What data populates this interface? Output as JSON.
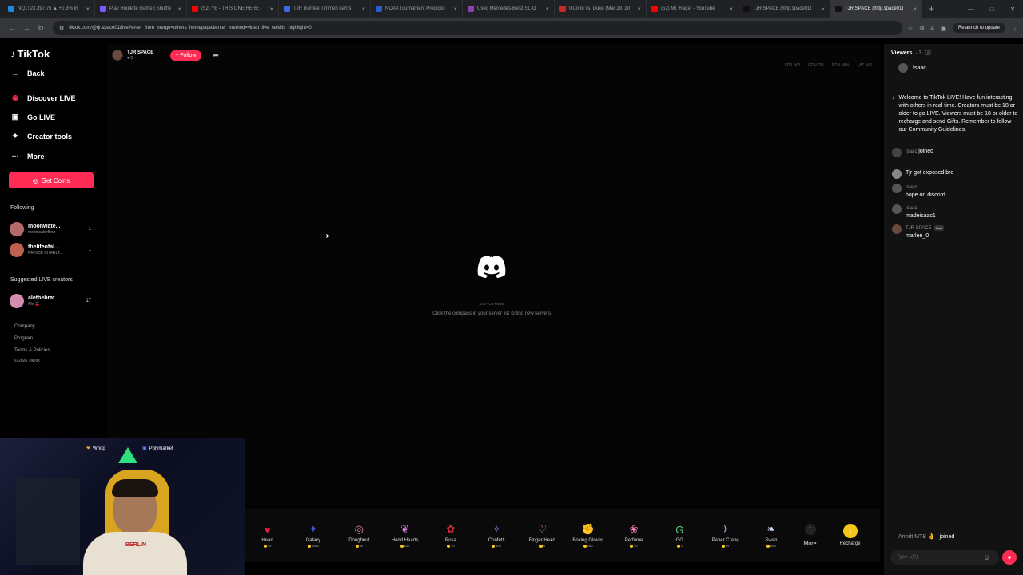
{
  "browser": {
    "tabs": [
      {
        "title": "NQ1! 23,397.75 ▲ +0.3% In",
        "color": "#1e88e5",
        "active": false
      },
      {
        "title": "Play Roulette Game | Shuffle",
        "color": "#7b5cff",
        "active": false
      },
      {
        "title": "(52) YE - THIS ONE HERE -",
        "color": "#ff0000",
        "active": false
      },
      {
        "title": "TJR mentee Timmeh earns",
        "color": "#3a6ae0",
        "active": false
      },
      {
        "title": "NCAA Tournament Predictio",
        "color": "#2a5bd7",
        "active": false
      },
      {
        "title": "Used Mercedes-Benz SL-Cl",
        "color": "#8e44ad",
        "active": false
      },
      {
        "title": "UConn vs. Duke (Mar 29, 20",
        "color": "#c62828",
        "active": false
      },
      {
        "title": "(52) Mr. Rager - YouTube",
        "color": "#ff0000",
        "active": false
      },
      {
        "title": "TJR SPACE (@tjr.space01)",
        "color": "#111111",
        "active": false
      },
      {
        "title": "TJR SPACE (@tjr.space01)",
        "color": "#111111",
        "active": true
      }
    ],
    "url": "tiktok.com/@tjr.space01/live?enter_from_merge=others_homepage&enter_method=video_live_cell&is_highlight=0",
    "relaunch": "Relaunch to update"
  },
  "sidebar": {
    "logo": "TikTok",
    "back": "Back",
    "nav": [
      {
        "label": "Discover LIVE",
        "icon": "live"
      },
      {
        "label": "Go LIVE",
        "icon": "video"
      },
      {
        "label": "Creator tools",
        "icon": "lightbulb"
      },
      {
        "label": "More",
        "icon": "more"
      }
    ],
    "coins_button": "Get Coins",
    "following_header": "Following",
    "following": [
      {
        "name": "moonwate...",
        "sub": "moonwaterfleur",
        "count": "1",
        "color": "#b46a6a"
      },
      {
        "name": "thelifeofal...",
        "sub": "PRINCE CHARLT...",
        "count": "1",
        "color": "#c06050"
      }
    ],
    "suggested_header": "Suggested LIVE creators",
    "suggested": [
      {
        "name": "alethebrat",
        "sub": "Ale 🍒",
        "count": "17",
        "color": "#d28db0"
      }
    ],
    "footer": [
      "Company",
      "Program",
      "Terms & Policies",
      "© 2026 TikTok"
    ]
  },
  "stream": {
    "host_name": "TJR SPACE",
    "host_sub": "♥ 0",
    "follow": "+ Follow",
    "stats": [
      "FPS N/A",
      "GPU 7%",
      "CPU 18%",
      "LAT N/A"
    ],
    "did_you_know": "DID YOU KNOW",
    "tip": "Click the compass in your server list to find new servers."
  },
  "gifts": [
    {
      "name": "Heart",
      "cost": "10",
      "color": "#e8213f",
      "glyph": "♥"
    },
    {
      "name": "Galaxy",
      "cost": "1000",
      "color": "#3a5bd9",
      "glyph": "✦"
    },
    {
      "name": "Doughnut",
      "cost": "30",
      "color": "#f08aa0",
      "glyph": "◎"
    },
    {
      "name": "Hand Hearts",
      "cost": "100",
      "color": "#d07ad0",
      "glyph": "❦"
    },
    {
      "name": "Rosa",
      "cost": "10",
      "color": "#d42a3c",
      "glyph": "✿"
    },
    {
      "name": "Confetti",
      "cost": "100",
      "color": "#6a8ad8",
      "glyph": "✧"
    },
    {
      "name": "Finger Heart",
      "cost": "5",
      "color": "#f4a08a",
      "glyph": "♡"
    },
    {
      "name": "Boxing Gloves",
      "cost": "299",
      "color": "#e05aa0",
      "glyph": "✊"
    },
    {
      "name": "Perfume",
      "cost": "20",
      "color": "#f07ab8",
      "glyph": "❀"
    },
    {
      "name": "GG",
      "cost": "1",
      "color": "#5ac87a",
      "glyph": "G"
    },
    {
      "name": "Paper Crane",
      "cost": "99",
      "color": "#8a9ad8",
      "glyph": "✈"
    },
    {
      "name": "Swan",
      "cost": "699",
      "color": "#c9d4ff",
      "glyph": "❧"
    }
  ],
  "gift_more": "More",
  "recharge": "Recharge",
  "webcam": {
    "sponsor1": "Whop",
    "sponsor2": "Polymarket",
    "shirt_text": "BERLIN"
  },
  "chat": {
    "viewers_label": "Viewers",
    "viewers_count": "· 3",
    "viewer_name": "Isaac",
    "welcome": "Welcome to TikTok LIVE! Have fun interacting with others in real time. Creators must be 18 or older to go LIVE. Viewers must be 18 or older to recharge and send Gifts. Remember to follow our Community Guidelines.",
    "messages": [
      {
        "name": "Isaac",
        "text": "joined",
        "inline": true
      },
      {
        "name": "",
        "text": "Tjr got exposed bro",
        "inline": true
      },
      {
        "name": "Isaac",
        "text": "hope on discord",
        "inline": false
      },
      {
        "name": "Isaac",
        "text": "madeisaac1",
        "inline": false
      },
      {
        "name": "TJR SPACE",
        "text": "marlen_0",
        "inline": false,
        "host": "Host"
      }
    ],
    "bottom_join_name": "Armitt MTB 👌",
    "bottom_join_text": "joined",
    "input_placeholder": "Type...(C)"
  }
}
